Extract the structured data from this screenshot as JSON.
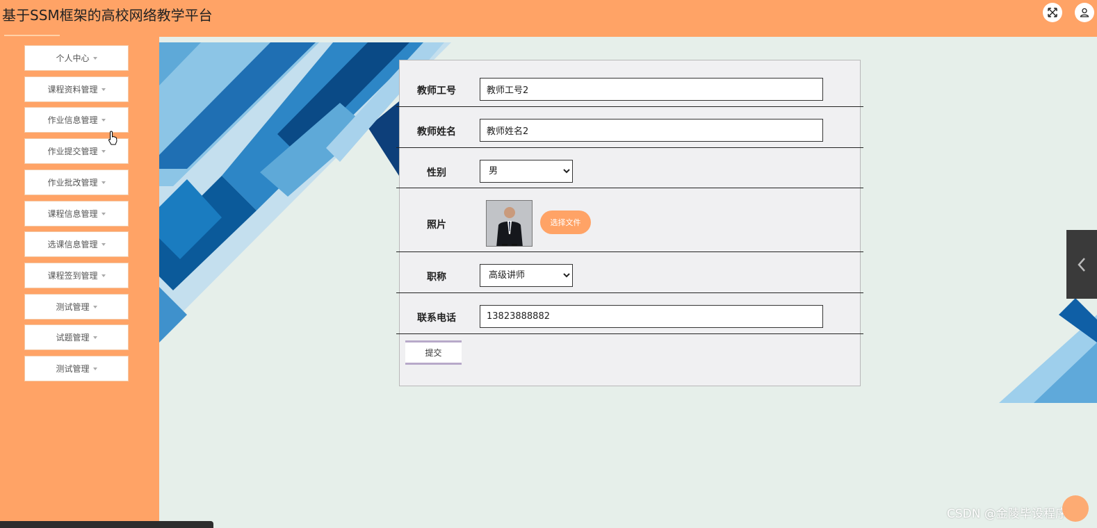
{
  "app": {
    "title": "基于SSM框架的高校网络教学平台"
  },
  "header_icons": [
    "fullscreen-icon",
    "user-icon"
  ],
  "sidebar": {
    "items": [
      {
        "label": "个人中心"
      },
      {
        "label": "课程资料管理"
      },
      {
        "label": "作业信息管理"
      },
      {
        "label": "作业提交管理"
      },
      {
        "label": "作业批改管理"
      },
      {
        "label": "课程信息管理"
      },
      {
        "label": "选课信息管理"
      },
      {
        "label": "课程签到管理"
      },
      {
        "label": "测试管理"
      },
      {
        "label": "试题管理"
      },
      {
        "label": "测试管理"
      }
    ]
  },
  "form": {
    "teacher_id": {
      "label": "教师工号",
      "value": "教师工号2"
    },
    "teacher_name": {
      "label": "教师姓名",
      "value": "教师姓名2"
    },
    "gender": {
      "label": "性别",
      "value": "男"
    },
    "photo": {
      "label": "照片",
      "button": "选择文件"
    },
    "title": {
      "label": "职称",
      "value": "高级讲师"
    },
    "phone": {
      "label": "联系电话",
      "value": "13823888882"
    },
    "submit_label": "提交"
  },
  "watermark": "CSDN @金陵毕设程序",
  "colors": {
    "accent": "#ffa366",
    "background": "#e6efea",
    "panel": "#f0f0f2"
  }
}
